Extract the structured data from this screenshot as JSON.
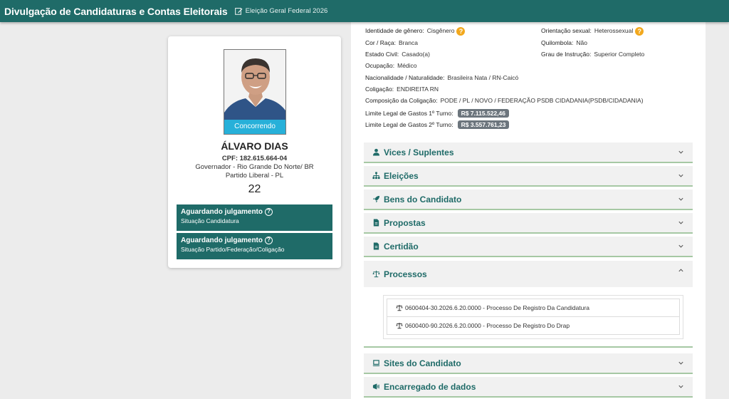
{
  "header": {
    "title": "Divulgação de Candidaturas e Contas Eleitorais",
    "election": "Eleição Geral Federal 2026"
  },
  "candidate": {
    "status_badge": "Concorrendo",
    "name": "ÁLVARO DIAS",
    "cpf": "CPF: 182.615.664-04",
    "cargo": "Governador - Rio Grande Do Norte/ BR",
    "partido": "Partido Liberal - PL",
    "number": "22",
    "situations": [
      {
        "title": "Aguardando julgamento",
        "subtitle": "Situação Candidatura"
      },
      {
        "title": "Aguardando julgamento",
        "subtitle": "Situação Partido/Federação/Coligação"
      }
    ]
  },
  "details": {
    "identidade": {
      "label": "Identidade de gênero:",
      "value": "Cisgênero"
    },
    "orientacao": {
      "label": "Orientação sexual:",
      "value": "Heterossexual"
    },
    "cor": {
      "label": "Cor / Raça:",
      "value": "Branca"
    },
    "quilombola": {
      "label": "Quilombola:",
      "value": "Não"
    },
    "estado_civil": {
      "label": "Estado Civil:",
      "value": "Casado(a)"
    },
    "grau": {
      "label": "Grau de Instrução:",
      "value": "Superior Completo"
    },
    "ocupacao": {
      "label": "Ocupação:",
      "value": "Médico"
    },
    "nacionalidade": {
      "label": "Nacionalidade / Naturalidade:",
      "value": "Brasileira Nata / RN-Caicó"
    },
    "coligacao": {
      "label": "Coligação:",
      "value": "ENDIREITA RN"
    },
    "composicao": {
      "label": "Composição da Coligação:",
      "value": "PODE / PL / NOVO / FEDERAÇÃO PSDB CIDADANIA(PSDB/CIDADANIA)"
    },
    "limite1": {
      "label": "Limite Legal de Gastos 1º Turno:",
      "value": "R$ 7.115.522,46"
    },
    "limite2": {
      "label": "Limite Legal de Gastos 2º Turno:",
      "value": "R$ 3.557.761,23"
    }
  },
  "accordion": {
    "vices": "Vices / Suplentes",
    "eleicoes": "Eleições",
    "bens": "Bens do Candidato",
    "propostas": "Propostas",
    "certidao": "Certidão",
    "processos": "Processos",
    "sites": "Sites do Candidato",
    "encarregado": "Encarregado de dados"
  },
  "processos": [
    "0600404-30.2026.6.20.0000 - Processo De Registro Da Candidatura",
    "0600400-90.2026.6.20.0000 - Processo De Registro Do Drap"
  ],
  "colors": {
    "brand": "#1f6b68",
    "badge": "#27b0d9",
    "warning": "#f2a81d",
    "accent_border": "#a6c8a4"
  }
}
